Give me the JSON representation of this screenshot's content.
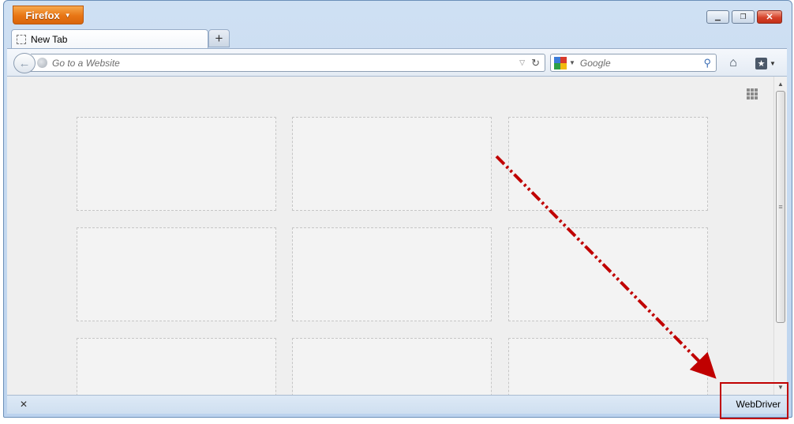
{
  "window": {
    "app_button_label": "Firefox",
    "controls": {
      "minimize_glyph": "▁",
      "restore_glyph": "❐",
      "close_glyph": "✕"
    }
  },
  "tabs": [
    {
      "label": "New Tab"
    }
  ],
  "new_tab_glyph": "+",
  "navbar": {
    "url_placeholder": "Go to a Website",
    "search_placeholder": "Google"
  },
  "newtab_page": {
    "tile_count": 9
  },
  "statusbar": {
    "close_glyph": "✕",
    "label": "WebDriver"
  },
  "annotation": {
    "color": "#c00000"
  },
  "icons": [
    "firefox-menu-caret-icon",
    "tab-placeholder-icon",
    "back-arrow-icon",
    "globe-icon",
    "dropdown-arrow-icon",
    "reload-icon",
    "google-icon",
    "search-magnifier-icon",
    "home-icon",
    "bookmark-star-icon",
    "tile-grid-icon"
  ]
}
